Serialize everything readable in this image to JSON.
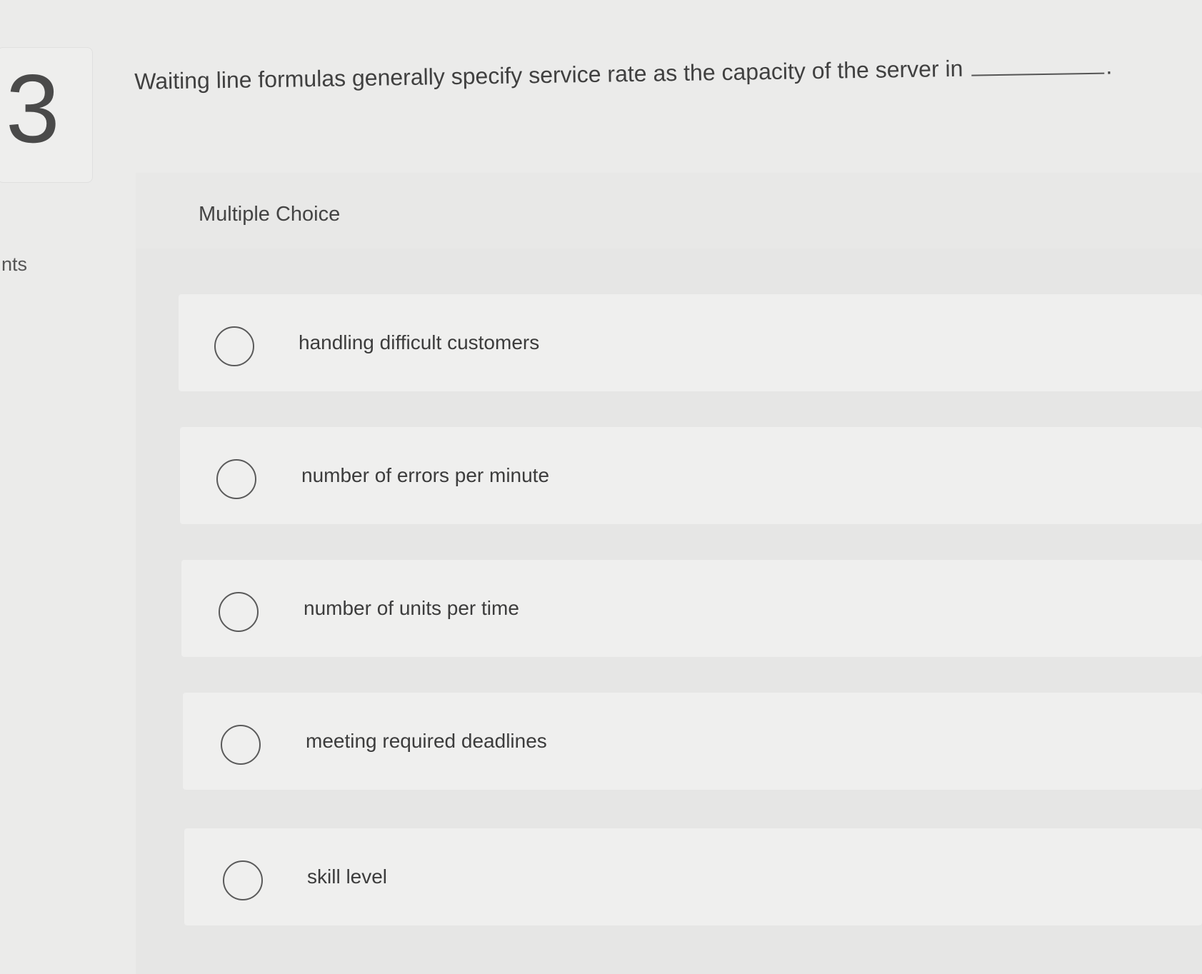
{
  "question": {
    "number": "3",
    "points_fragment": "nts",
    "text": "Waiting line formulas generally specify service rate as the capacity of the server in",
    "trailing_punctuation": "."
  },
  "answer_section": {
    "type_label": "Multiple Choice",
    "options": [
      {
        "label": "handling difficult customers",
        "selected": false
      },
      {
        "label": "number of errors per minute",
        "selected": false
      },
      {
        "label": "number of units per time",
        "selected": false
      },
      {
        "label": "meeting required deadlines",
        "selected": false
      },
      {
        "label": "skill level",
        "selected": false
      }
    ]
  }
}
